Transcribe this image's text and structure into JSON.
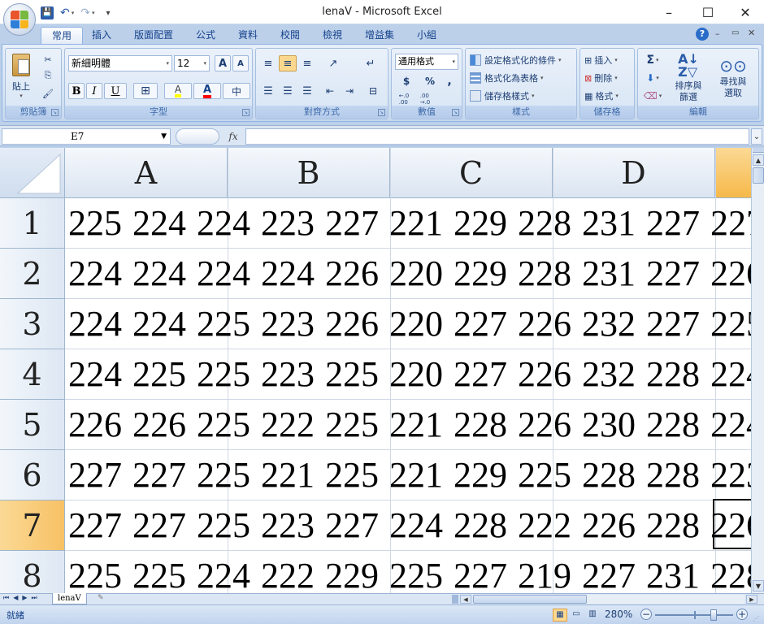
{
  "window": {
    "title": "lenaV - Microsoft Excel",
    "minimize": "–",
    "maximize": "☐",
    "close": "✕"
  },
  "qat": {
    "save": "💾",
    "undo": "↶",
    "redo": "↷",
    "customize": "▾"
  },
  "tabs": [
    "常用",
    "插入",
    "版面配置",
    "公式",
    "資料",
    "校閱",
    "檢視",
    "增益集",
    "小組"
  ],
  "active_tab": "常用",
  "ribbon": {
    "clipboard": {
      "label": "剪貼簿",
      "paste": "貼上",
      "cut": "✂",
      "copy": "⎘",
      "format_painter": "🖌"
    },
    "font": {
      "label": "字型",
      "name": "新細明體",
      "size": "12",
      "grow": "A",
      "shrink": "A",
      "bold": "B",
      "italic": "I",
      "underline": "U",
      "border": "⊞",
      "fill": "A",
      "fontcolor": "A",
      "phonetic": "中"
    },
    "alignment": {
      "label": "對齊方式"
    },
    "number": {
      "label": "數值",
      "format": "通用格式",
      "currency": "$",
      "percent": "%",
      "comma": ",",
      "inc": "←.0\n.00",
      "dec": ".00\n→.0"
    },
    "styles": {
      "label": "樣式",
      "conditional": "設定格式化的條件",
      "table": "格式化為表格",
      "cellstyles": "儲存格樣式"
    },
    "cells": {
      "label": "儲存格",
      "insert": "插入",
      "delete": "刪除",
      "format": "格式"
    },
    "editing": {
      "label": "編輯",
      "sum": "Σ",
      "sort": "排序與\n篩選",
      "find": "尋找與\n選取"
    }
  },
  "formula_bar": {
    "name_box": "E7",
    "fx": "fx",
    "value": ""
  },
  "columns": [
    "A",
    "B",
    "C",
    "D"
  ],
  "selected_column": "E",
  "selected_row": "7",
  "active_cell": "E7",
  "rows": [
    {
      "num": "1",
      "values": "225 224 224 223 227 221 229 228 231 227 227 2"
    },
    {
      "num": "2",
      "values": "224 224 224 224 226 220 229 228 231 227 226 2"
    },
    {
      "num": "3",
      "values": "224 224 225 223 226 220 227 226 232 227 225 2"
    },
    {
      "num": "4",
      "values": "224 225 225 223 225 220 227 226 232 228 224 2"
    },
    {
      "num": "5",
      "values": "226 226 225 222 225 221 228 226 230 228 224 2"
    },
    {
      "num": "6",
      "values": "227 227 225 221 225 221 229 225 228 228 223 2"
    },
    {
      "num": "7",
      "values": "227 227 225 223 227 224 228 222 226 228 226 2"
    },
    {
      "num": "8",
      "values": "225 225 224 222 229 225 227 219 227 231 228 2"
    }
  ],
  "sheet_tabs": [
    "lenaV"
  ],
  "status": {
    "ready": "就緒",
    "zoom": "280%"
  },
  "colors": {
    "accent": "#15428b",
    "selected_header": "#f7c165",
    "ribbon_bg": "#d2e1f3"
  }
}
